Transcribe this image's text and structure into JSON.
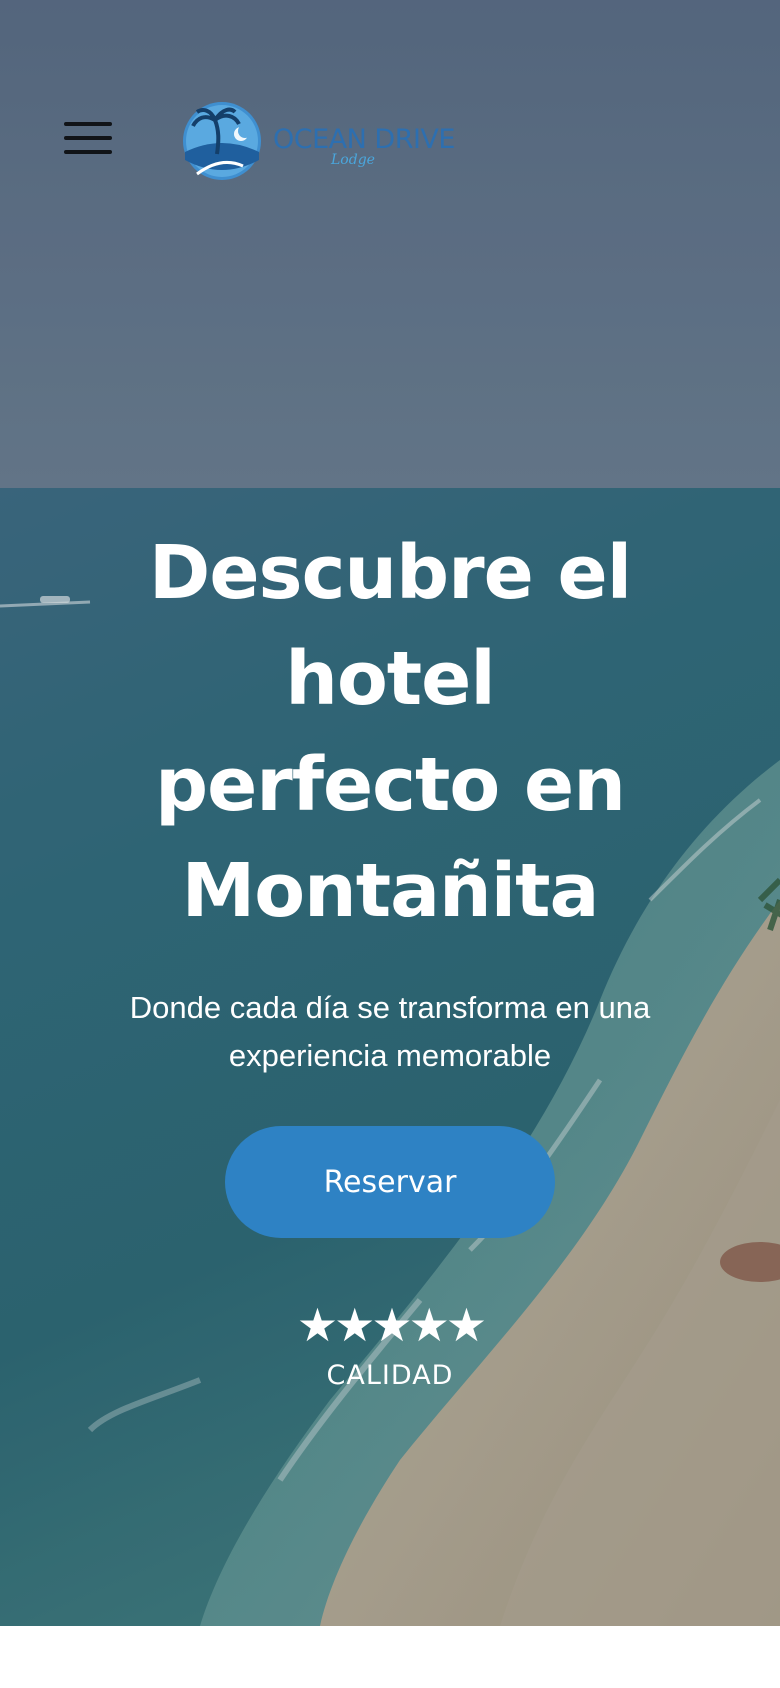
{
  "header": {
    "menu_icon": "hamburger-menu-icon",
    "logo": {
      "text": "OCEAN DRIVE",
      "script": "Lodge",
      "icon": "palm-tree-logo-icon"
    }
  },
  "hero": {
    "title_lines": [
      "Descubre el hotel",
      "perfecto en",
      "Montañita"
    ],
    "subtitle_lines": [
      "Donde cada día se transforma en una",
      "experiencia memorable"
    ],
    "cta_label": "Reservar",
    "rating": {
      "stars": "★★★★★",
      "value": 5,
      "max": 5,
      "label": "CALIDAD"
    }
  },
  "colors": {
    "accent": "#2e82c4",
    "logo_blue": "#2d6fb0",
    "text_on_hero": "#ffffff",
    "sky": "#5e7088",
    "sea_dark": "#2d5a6e",
    "sand": "#b6aa92"
  }
}
